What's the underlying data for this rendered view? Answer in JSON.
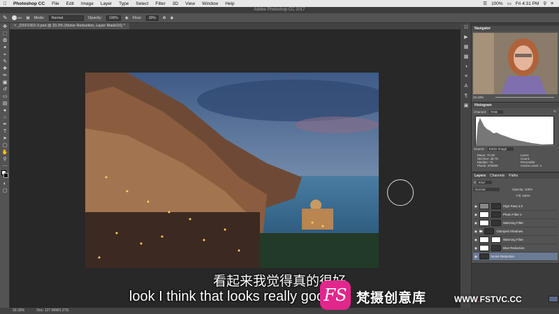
{
  "menubar": {
    "apple_icon": "apple-icon",
    "items": [
      "Photoshop CC",
      "File",
      "Edit",
      "Image",
      "Layer",
      "Type",
      "Select",
      "Filter",
      "3D",
      "View",
      "Window",
      "Help"
    ],
    "battery": "100%",
    "clock": "Fri 4:31 PM"
  },
  "window_title": "Adobe Photoshop CC 2017",
  "options": {
    "brush_size": "200",
    "mode_label": "Mode:",
    "mode_value": "Normal",
    "opacity_label": "Opacity:",
    "opacity_value": "100%",
    "flow_label": "Flow:",
    "flow_value": "30%"
  },
  "document_tab": "_DSF2302-3.psd @ 33.3% (Noise Reduction, Layer Mask/16) *",
  "navigator": {
    "title": "Navigator",
    "zoom": "33.33%"
  },
  "histogram": {
    "title": "Histogram",
    "channel_label": "Channel:",
    "channel_value": "RGB",
    "source_label": "Source:",
    "source_value": "Entire Image",
    "stats_left": [
      "Mean: 70.30",
      "Std Dev: 48.75",
      "Median: 74",
      "Pixels: 375000"
    ],
    "stats_right": [
      "Level:",
      "Count:",
      "Percentile:",
      "Cache Level: 4"
    ]
  },
  "layers": {
    "tabs": [
      "Layers",
      "Channels",
      "Paths"
    ],
    "kind": "Kind",
    "blend": "Normal",
    "opacity": "Opacity: 100%",
    "fill": "Fill: 100%",
    "items": [
      "High Pass 2.0",
      "Photo Filter 1",
      "Warming Filter",
      "Clamped Shadows",
      "Warming Filter",
      "Blue Reduction",
      "Noise Reduction"
    ]
  },
  "statusbar": {
    "zoom": "33.33%",
    "doc": "Doc: 127.96M/1.27G"
  },
  "subtitles": {
    "chinese": "看起来我觉得真的很好",
    "english": "look I think that looks really good"
  },
  "watermark": {
    "logo_text": "FS",
    "name": "梵摄创意库",
    "url_prefix": "WWW",
    "url_domain": "FSTVC.CC"
  },
  "colors": {
    "brand": "#e2278c",
    "ps_panel": "#535353",
    "ps_canvas": "#282828"
  }
}
